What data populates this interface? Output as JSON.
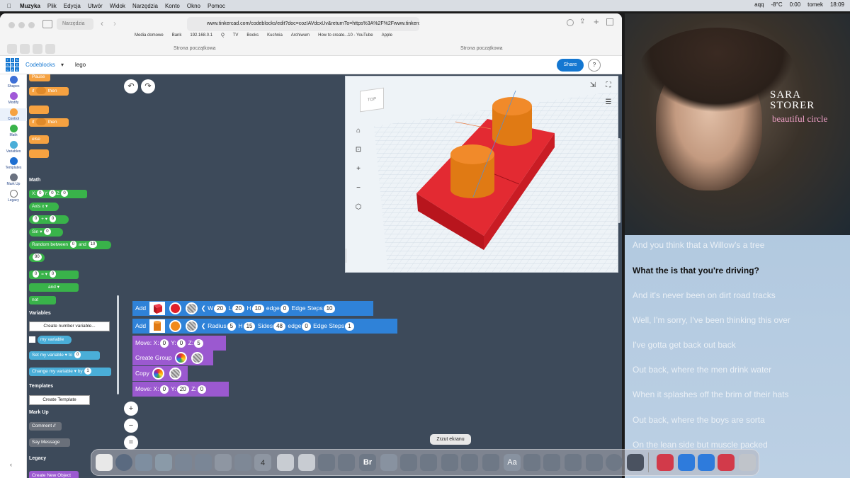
{
  "menubar": {
    "apple": "",
    "app_name": "Muzyka",
    "items": [
      "Plik",
      "Edycja",
      "Utwór",
      "Widok",
      "Narzędzia",
      "Konto",
      "Okno",
      "Pomoc"
    ],
    "right": {
      "temp": "-8°C",
      "clock": "18:09",
      "user": "tomek",
      "timer": "0:00",
      "user2": "aqq"
    }
  },
  "safari": {
    "sidebar_label": "Narzędzia",
    "url": "www.tinkercad.com/codeblocks/edit?doc=cozIAVdcxUv&returnTo=https%3A%2F%2Fwww.tinkercad.com%2Fdashboard",
    "bookmarks": [
      "Media domowe",
      "Bank",
      "192.168.0.1",
      "Q",
      "TV",
      "Books",
      "Kuchnia",
      "Archiwum",
      "How to create...10 - YouTube",
      "Apple"
    ],
    "tabs": [
      "Strona początkowa",
      "Strona początkowa"
    ]
  },
  "tinkercad": {
    "logo_letters": [
      "TIN",
      "KER",
      "CAD"
    ],
    "mode": "Codeblocks",
    "project_name": "lego",
    "share_label": "Share",
    "help_label": "?"
  },
  "categories": [
    {
      "label": "Shapes",
      "color": "#3d6fd6"
    },
    {
      "label": "Modify",
      "color": "#a159d8"
    },
    {
      "label": "Control",
      "color": "#f6a241"
    },
    {
      "label": "Math",
      "color": "#39b34a"
    },
    {
      "label": "Variables",
      "color": "#4aaed8"
    },
    {
      "label": "Templates",
      "color": "#1f6fd1"
    },
    {
      "label": "Mark Up",
      "color": "#6b7280"
    },
    {
      "label": "Legacy",
      "color": "#ffffff"
    }
  ],
  "palette": {
    "pause": "Pause",
    "if1": "if",
    "then1": "then",
    "if2": "if",
    "then2": "then",
    "else": "else",
    "math_header": "Math",
    "xyz": {
      "x": "X:",
      "xv": "0",
      "y": "Y:",
      "yv": "0",
      "z": "Z:",
      "zv": "0"
    },
    "axis": "Axis x ▾",
    "plus": {
      "a": "0",
      "op": "+ ▾",
      "b": "0"
    },
    "sin": {
      "fn": "Sin ▾",
      "v": "0"
    },
    "random": {
      "label": "Random between",
      "a": "0",
      "and": "and",
      "b": "10"
    },
    "ninety": "90",
    "compare": {
      "a": "0",
      "op": "= ▾",
      "b": "0"
    },
    "and_block": "and ▾",
    "not_block": "not",
    "variables_header": "Variables",
    "create_var": "Create number variable...",
    "my_variable": "my variable",
    "set": {
      "label": "Set",
      "var": "my variable ▾",
      "to": "to",
      "v": "0"
    },
    "change": {
      "label": "Change",
      "var": "my variable ▾",
      "by": "by",
      "v": "1"
    },
    "templates_header": "Templates",
    "create_template": "Create Template",
    "markup_header": "Mark Up",
    "comment": "Comment //",
    "say": {
      "label": "Say",
      "msg": "Message"
    },
    "legacy_header": "Legacy",
    "create_new_object": "Create New Object"
  },
  "workspace": {
    "undo": "↶",
    "redo": "↷",
    "zoom_in": "+",
    "zoom_out": "−",
    "zoom_reset": "=",
    "viewcube_label": "TOP",
    "blocks": {
      "box": {
        "add": "Add",
        "w": "W",
        "wv": "20",
        "l": "L",
        "lv": "20",
        "h": "H",
        "hv": "10",
        "edge": "edge",
        "edgev": "0",
        "steps": "Edge Steps",
        "stepsv": "10",
        "color": "#e0202a"
      },
      "cyl": {
        "add": "Add",
        "radius": "Radius",
        "rv": "5",
        "h": "H",
        "hv": "15",
        "sides": "Sides",
        "sv": "48",
        "edge": "edge",
        "edgev": "0",
        "steps": "Edge Steps",
        "stepsv": "1",
        "color": "#f18a1c"
      },
      "move1": {
        "label": "Move:",
        "x": "X:",
        "xv": "0",
        "y": "Y:",
        "yv": "0",
        "z": "Z:",
        "zv": "5"
      },
      "group": {
        "label": "Create Group"
      },
      "copy": {
        "label": "Copy"
      },
      "move2": {
        "label": "Move:",
        "x": "X:",
        "xv": "0",
        "y": "Y:",
        "yv": "20",
        "z": "Z:",
        "zv": "0"
      }
    }
  },
  "music": {
    "album_artist": "SARA STORER",
    "album_title": "beautiful circle",
    "lyrics": [
      "And you think that a Willow's a tree",
      "What the is that you're driving?",
      "And it's never been on dirt road tracks",
      "Well, I'm sorry, I've been thinking this over",
      "I've gotta get back out back",
      "Out back, where the men drink water",
      "When it splashes off the brim of their hats",
      "Out back, where the boys are sorta",
      "On the lean side but muscle packed"
    ]
  },
  "dock": {
    "tooltip": "Zrzut ekranu",
    "calendar_day": "4",
    "br_label": "Br",
    "aa_label": "Aa"
  }
}
